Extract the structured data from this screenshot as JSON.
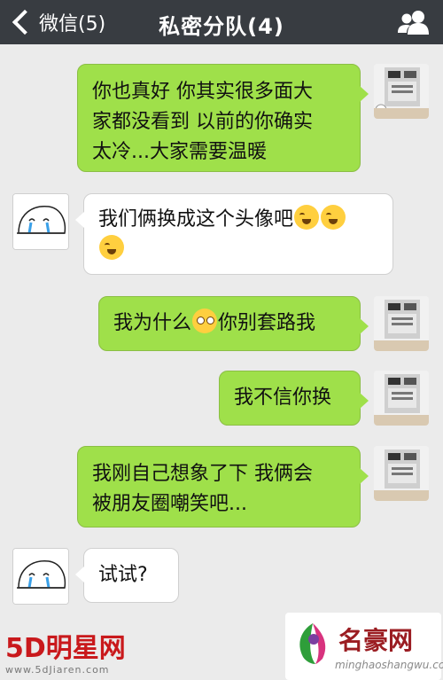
{
  "header": {
    "back_label": "微信(5)",
    "title": "私密分队(4)"
  },
  "messages": [
    {
      "side": "me",
      "text_lines": [
        "你也真好 你其实很多面大",
        "家都没看到 以前的你确实",
        "太冷...大家需要温暖"
      ]
    },
    {
      "side": "other",
      "text": "我们俩换成这个头像吧"
    },
    {
      "side": "me",
      "text_a": "我为什么",
      "text_b": "你别套路我"
    },
    {
      "side": "me",
      "text": "我不信你换"
    },
    {
      "side": "me",
      "text_lines": [
        "我刚自己想象了下 我俩会",
        "被朋友圈嘲笑吧..."
      ]
    },
    {
      "side": "other",
      "text": "试试?"
    }
  ],
  "watermarks": {
    "left_brand_a": "5D",
    "left_brand_b": "明星网",
    "left_url": "www.5dJiaren.com",
    "right_brand": "名豪网",
    "right_url": "minghaoshangwu.com"
  },
  "colors": {
    "header_bg": "#383c41",
    "my_bubble": "#9fe04a",
    "other_bubble": "#ffffff",
    "chat_bg": "#ebebeb"
  },
  "icons": [
    "chevron-left-icon",
    "group-members-icon",
    "crying-laughing-emoji",
    "wide-eyed-emoji"
  ]
}
